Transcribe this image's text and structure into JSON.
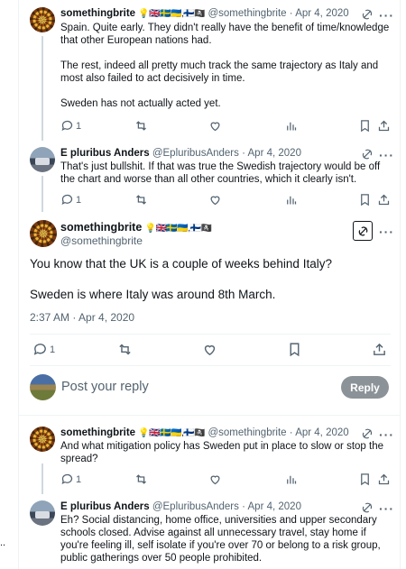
{
  "tweets": [
    {
      "name": "somethingbrite",
      "flags": "💡🇬🇧🇸🇪🇺🇦,🇫🇮🏴‍☠️",
      "handle": "@somethingbrite",
      "date": "Apr 4, 2020",
      "paragraphs": [
        "Spain. Quite early. They didn't really have the benefit of time/knowledge that other European nations had.",
        "The rest, indeed all pretty much track the same trajectory as Italy and most also failed to act decisively in time.",
        "Sweden has not actually acted yet."
      ],
      "reply_count": "1"
    },
    {
      "name": "E pluribus Anders",
      "handle": "@EpluribusAnders",
      "date": "Apr 4, 2020",
      "paragraphs": [
        "That's just bullshit. If that was true the Swedish trajectory would be off the chart and worse than all other countries, which it clearly isn't."
      ],
      "reply_count": "1"
    }
  ],
  "main_tweet": {
    "name": "somethingbrite",
    "flags": "💡🇬🇧🇸🇪🇺🇦,🇫🇮🏴‍☠️",
    "handle": "@somethingbrite",
    "paragraphs": [
      "You know that the UK is a couple of weeks behind Italy?",
      "Sweden is where Italy was around 8th March."
    ],
    "timestamp": "2:37 AM · Apr 4, 2020",
    "reply_count": "1"
  },
  "compose": {
    "placeholder": "Post your reply",
    "button_label": "Reply"
  },
  "replies": [
    {
      "name": "somethingbrite",
      "flags": "💡🇬🇧🇸🇪🇺🇦,🇫🇮🏴‍☠️",
      "handle": "@somethingbrite",
      "date": "Apr 4, 2020",
      "paragraphs": [
        "And what mitigation policy has Sweden put in place to slow or stop the spread?"
      ],
      "reply_count": "1"
    },
    {
      "name": "E pluribus Anders",
      "handle": "@EpluribusAnders",
      "date": "Apr 4, 2020",
      "paragraphs": [
        "Eh? Social distancing, home office, universities and upper secondary schools closed. Advise against all unnecessary travel, stay home if you're feeling ill, self isolate if you're over 70 or belong to a risk group, public gatherings over 50 people prohibited."
      ]
    }
  ],
  "side_text": "..",
  "separator": "·"
}
